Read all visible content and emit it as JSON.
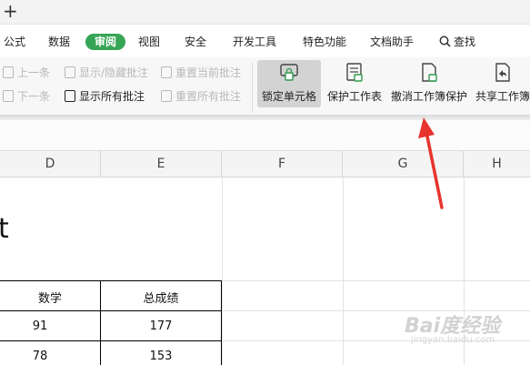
{
  "titlebar": {
    "new_tab_icon": "plus"
  },
  "menu": {
    "formula": "公式",
    "data": "数据",
    "review": "审阅",
    "view": "视图",
    "security": "安全",
    "developer": "开发工具",
    "features": "特色功能",
    "doc_helper": "文档助手",
    "search": "查找"
  },
  "ribbon": {
    "prev": "上一条",
    "next": "下一条",
    "show_hide_comment": "显示/隐藏批注",
    "show_all_comments": "显示所有批注",
    "reset_current_comment": "重置当前批注",
    "reset_all_comments": "重置所有批注",
    "lock_cell": "锁定单元格",
    "protect_sheet": "保护工作表",
    "unprotect_workbook": "撤消工作簿保护",
    "share_workbook": "共享工作簿"
  },
  "columns": [
    "D",
    "E",
    "F",
    "G",
    "H"
  ],
  "sheet": {
    "title_fragment": "t",
    "headers": [
      "数学",
      "总成绩"
    ],
    "rows": [
      [
        "91",
        "177"
      ],
      [
        "78",
        "153"
      ]
    ]
  },
  "watermark": {
    "main": "Bai度经验",
    "sub": "jingyan.baidu.com"
  },
  "colors": {
    "review_tab": "#37a556",
    "arrow": "#e8332e",
    "lock_button_bg": "#d3d3d3"
  }
}
